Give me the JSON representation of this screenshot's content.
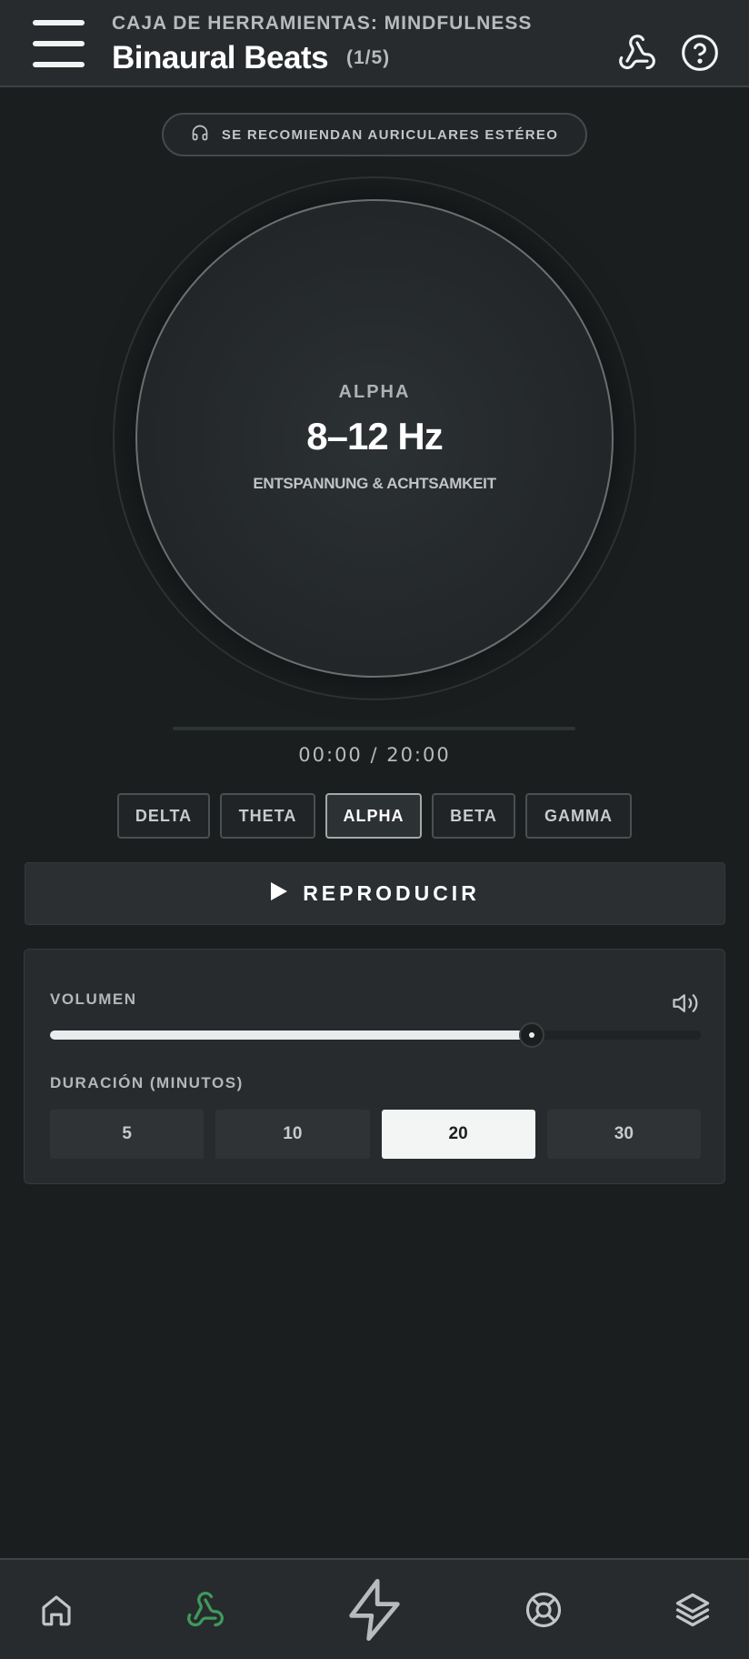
{
  "header": {
    "supertitle": "CAJA DE HERRAMIENTAS: MINDFULNESS",
    "title": "Binaural Beats",
    "counter": "(1/5)",
    "icons": [
      "menu-icon",
      "webhook-icon",
      "help-circle-icon"
    ]
  },
  "notice": {
    "icon": "headphones-icon",
    "text": "SE RECOMIENDAN AURICULARES ESTÉREO"
  },
  "current_band": {
    "name": "ALPHA",
    "frequency": "8–12 Hz",
    "description": "ENTSPANNUNG & ACHTSAMKEIT"
  },
  "playback": {
    "time": "00:00 / 20:00",
    "progress": 0
  },
  "bands": [
    {
      "label": "DELTA",
      "active": false
    },
    {
      "label": "THETA",
      "active": false
    },
    {
      "label": "ALPHA",
      "active": true
    },
    {
      "label": "BETA",
      "active": false
    },
    {
      "label": "GAMMA",
      "active": false
    }
  ],
  "play_button": {
    "icon": "play-icon",
    "label": "REPRODUCIR"
  },
  "settings": {
    "volume_label": "VOLUMEN",
    "volume_icon": "volume-icon",
    "volume_value": 0.74,
    "duration_label": "DURACIÓN (MINUTOS)",
    "durations": [
      {
        "label": "5",
        "active": false
      },
      {
        "label": "10",
        "active": false
      },
      {
        "label": "20",
        "active": true
      },
      {
        "label": "30",
        "active": false
      }
    ]
  },
  "bottom_nav": {
    "items": [
      "home-icon",
      "webhook-icon",
      "zap-icon",
      "lifebuoy-icon",
      "layers-icon"
    ],
    "active": "webhook-icon",
    "active_color": "#3f9a5a"
  }
}
